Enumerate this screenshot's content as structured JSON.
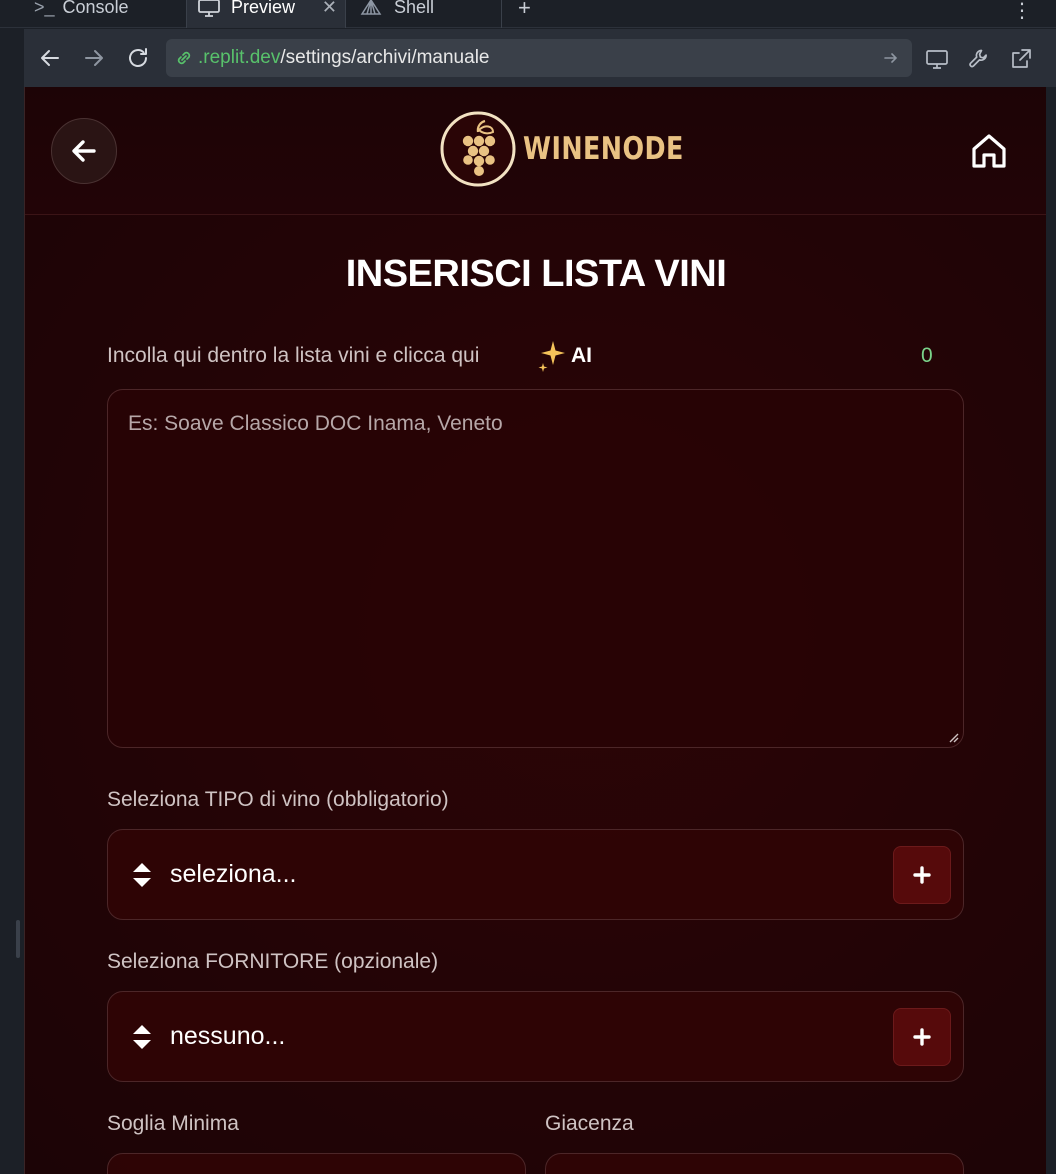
{
  "browser": {
    "tabs": [
      {
        "label": "Console",
        "icon": "terminal-icon"
      },
      {
        "label": "Preview",
        "icon": "monitor-icon",
        "active": true
      },
      {
        "label": "Shell",
        "icon": "shell-icon"
      }
    ],
    "url": {
      "host": ".replit.dev",
      "path": "/settings/archivi/manuale"
    }
  },
  "header": {
    "logo_text": "WINENODE"
  },
  "page": {
    "title": "INSERISCI LISTA VINI",
    "paste_label": "Incolla qui dentro la lista vini e clicca qui",
    "ai_label": "AI",
    "counter": "0",
    "textarea_placeholder": "Es: Soave Classico DOC Inama, Veneto",
    "tipo_label": "Seleziona TIPO di vino (obbligatorio)",
    "tipo_value": "seleziona...",
    "fornitore_label": "Seleziona FORNITORE (opzionale)",
    "fornitore_value": "nessuno...",
    "soglia_label": "Soglia Minima",
    "giacenza_label": "Giacenza"
  },
  "colors": {
    "background": "#230406",
    "accent_gold": "#e9c283",
    "counter_green": "#7bd38a",
    "plus_button": "#560a0b"
  }
}
